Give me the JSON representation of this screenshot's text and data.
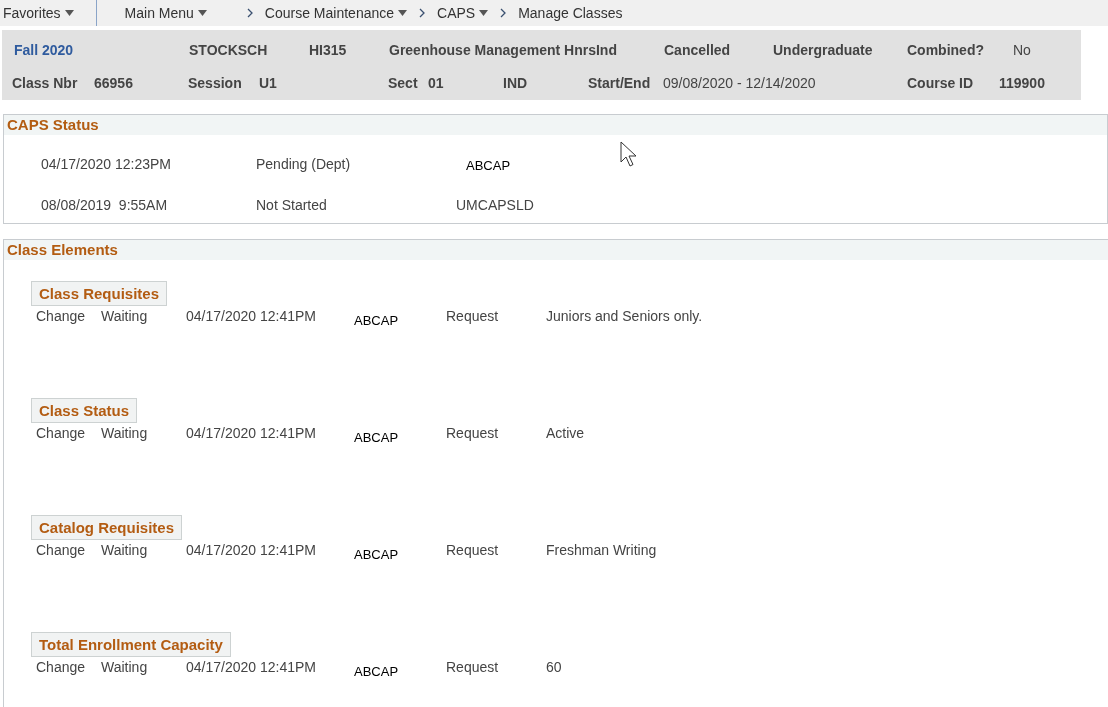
{
  "breadcrumb": {
    "favorites": "Favorites",
    "items": [
      {
        "label": "Main Menu",
        "dropdown": true
      },
      {
        "label": "Course Maintenance",
        "dropdown": true
      },
      {
        "label": "CAPS",
        "dropdown": true
      },
      {
        "label": "Manage Classes",
        "dropdown": false
      }
    ]
  },
  "class_header": {
    "row_1": [
      {
        "kind": "link",
        "text": "Fall 2020"
      },
      {
        "kind": "label",
        "text": "STOCKSCH"
      },
      {
        "kind": "label",
        "text": "HI315"
      },
      {
        "kind": "label",
        "text": "Greenhouse Management HnrsInd"
      },
      {
        "kind": "label",
        "text": "Cancelled"
      },
      {
        "kind": "label",
        "text": "Undergraduate"
      },
      {
        "kind": "label",
        "text": "Combined?"
      },
      {
        "kind": "value",
        "text": "No"
      }
    ],
    "row_2": [
      {
        "kind": "label",
        "text": "Class Nbr"
      },
      {
        "kind": "label",
        "text": "66956"
      },
      {
        "kind": "label",
        "text": "Session"
      },
      {
        "kind": "label",
        "text": "U1"
      },
      {
        "kind": "label",
        "text": "Sect"
      },
      {
        "kind": "label",
        "text": "01"
      },
      {
        "kind": "label",
        "text": "IND"
      },
      {
        "kind": "label",
        "text": "Start/End"
      },
      {
        "kind": "value",
        "text": "09/08/2020 - 12/14/2020"
      },
      {
        "kind": "label",
        "text": "Course ID"
      },
      {
        "kind": "label",
        "text": "119900"
      }
    ]
  },
  "caps_status": {
    "title": "CAPS Status",
    "rows": [
      {
        "datetime": "04/17/2020 12:23PM",
        "status": "Pending (Dept)",
        "user": "ABCAP"
      },
      {
        "datetime": "08/08/2019  9:55AM",
        "status": "Not Started",
        "user": "UMCAPSLD"
      }
    ]
  },
  "class_elements": {
    "title": "Class Elements",
    "items": [
      {
        "name": "Class Requisites",
        "action": "Change",
        "state": "Waiting",
        "datetime": "04/17/2020 12:41PM",
        "user": "ABCAP",
        "type": "Request",
        "value": "Juniors and Seniors only."
      },
      {
        "name": "Class Status",
        "action": "Change",
        "state": "Waiting",
        "datetime": "04/17/2020 12:41PM",
        "user": "ABCAP",
        "type": "Request",
        "value": "Active"
      },
      {
        "name": "Catalog Requisites",
        "action": "Change",
        "state": "Waiting",
        "datetime": "04/17/2020 12:41PM",
        "user": "ABCAP",
        "type": "Request",
        "value": "Freshman Writing"
      },
      {
        "name": "Total Enrollment Capacity",
        "action": "Change",
        "state": "Waiting",
        "datetime": "04/17/2020 12:41PM",
        "user": "ABCAP",
        "type": "Request",
        "value": "60"
      }
    ]
  }
}
